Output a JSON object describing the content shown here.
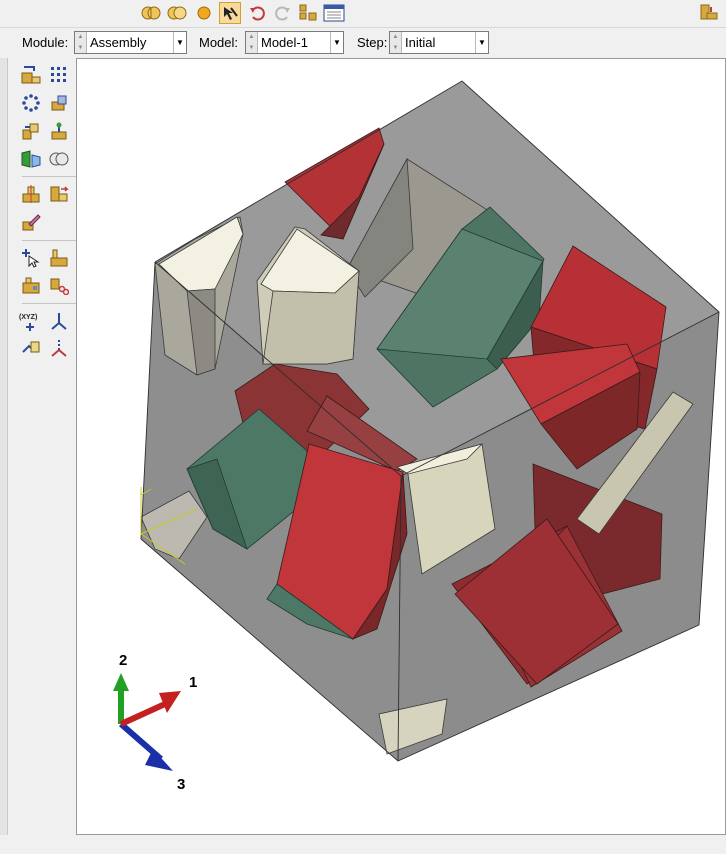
{
  "context": {
    "module_label": "Module:",
    "module_value": "Assembly",
    "model_label": "Model:",
    "model_value": "Model-1",
    "step_label": "Step:",
    "step_value": "Initial"
  },
  "triad": {
    "axis_1": "1",
    "axis_2": "2",
    "axis_3": "3"
  },
  "coord_button_label": "(XYZ)",
  "colors": {
    "grain_red": "#b23236",
    "grain_green": "#3f6e5a",
    "grain_cream": "#e8e6d4",
    "cube": "#8a8a8a",
    "axis_x": "#c42020",
    "axis_y": "#22a022",
    "axis_z": "#1a2fa8"
  }
}
